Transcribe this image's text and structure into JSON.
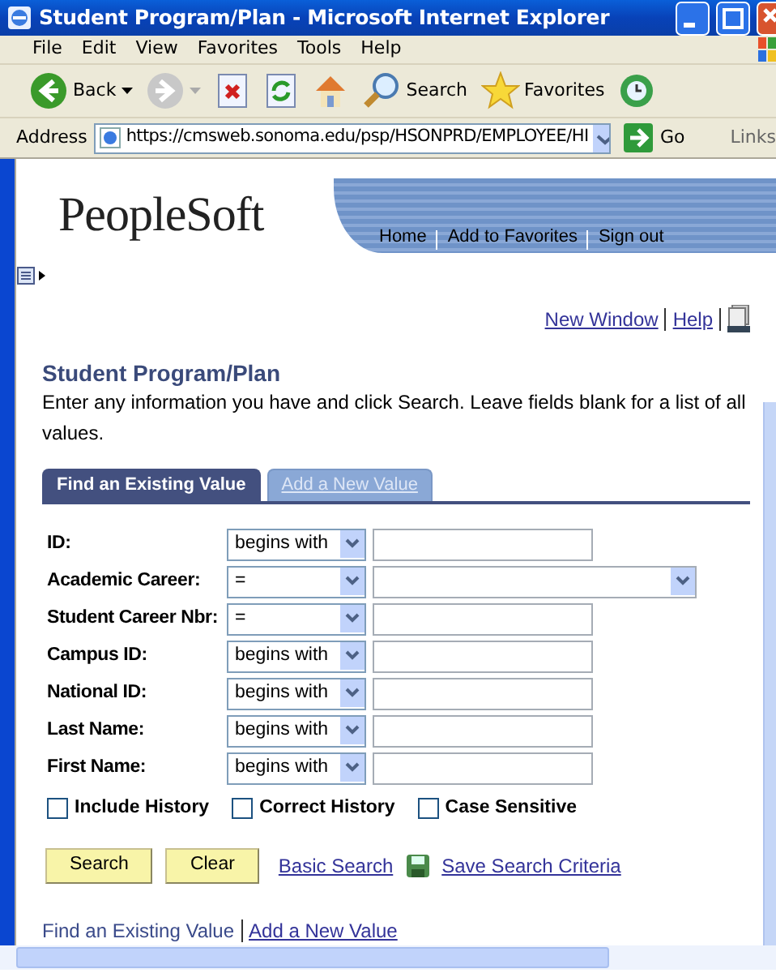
{
  "window": {
    "title": "Student Program/Plan - Microsoft Internet Explorer"
  },
  "menu": [
    "File",
    "Edit",
    "View",
    "Favorites",
    "Tools",
    "Help"
  ],
  "toolbar": [
    {
      "kind": "back",
      "label": "Back"
    },
    {
      "kind": "forward"
    },
    {
      "kind": "stop"
    },
    {
      "kind": "refresh"
    },
    {
      "kind": "home"
    },
    {
      "kind": "search",
      "label": "Search"
    },
    {
      "kind": "favorites",
      "label": "Favorites"
    },
    {
      "kind": "history"
    }
  ],
  "address_bar": {
    "label": "Address",
    "url": "https://cmsweb.sonoma.edu/psp/HSONPRD/EMPLOYEE/HI",
    "go": "Go",
    "links": "Links"
  },
  "header": {
    "logo": "PeopleSoft",
    "links": [
      "Home",
      "Add to Favorites",
      "Sign out"
    ]
  },
  "page_links": [
    "New Window",
    "Help"
  ],
  "page": {
    "title": "Student Program/Plan",
    "instructions": "Enter any information you have and click Search. Leave fields blank for a list of all values."
  },
  "tabs": [
    {
      "label": "Find an Existing Value",
      "selected": true
    },
    {
      "label": "Add a New Value",
      "selected": false
    }
  ],
  "fields": [
    {
      "label": "ID:",
      "operator": "begins with",
      "kind": "text"
    },
    {
      "label": "Academic Career:",
      "operator": "=",
      "kind": "dropdown"
    },
    {
      "label": "Student Career Nbr:",
      "operator": "=",
      "kind": "text"
    },
    {
      "label": "Campus ID:",
      "operator": "begins with",
      "kind": "text"
    },
    {
      "label": "National ID:",
      "operator": "begins with",
      "kind": "text"
    },
    {
      "label": "Last Name:",
      "operator": "begins with",
      "kind": "text"
    },
    {
      "label": "First Name:",
      "operator": "begins with",
      "kind": "text"
    }
  ],
  "options": [
    {
      "label": "Include History",
      "checked": false
    },
    {
      "label": "Correct History",
      "checked": false
    },
    {
      "label": "Case Sensitive",
      "checked": false
    }
  ],
  "buttons": [
    "Search",
    "Clear"
  ],
  "search_links": {
    "basic": "Basic Search",
    "save": "Save Search Criteria"
  },
  "footer_links": [
    {
      "label": "Find an Existing Value",
      "selected": true
    },
    {
      "label": "Add a New Value",
      "selected": false
    }
  ]
}
